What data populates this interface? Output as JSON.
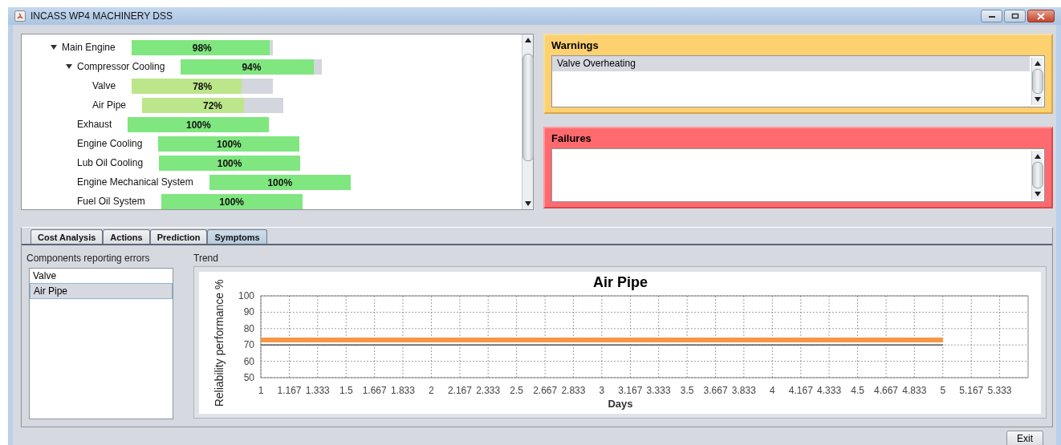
{
  "window": {
    "title": "INCASS WP4 MACHINERY DSS"
  },
  "tree": [
    {
      "label": "Main Engine",
      "level": 0.98,
      "reading": "98%",
      "expanded": true,
      "children": [
        {
          "label": "Compressor Cooling",
          "level": 0.94,
          "reading": "94%",
          "expanded": true,
          "children": [
            {
              "label": "Valve",
              "level": 0.78,
              "reading": "78%"
            },
            {
              "label": "Air Pipe",
              "level": 0.72,
              "reading": "72%"
            }
          ]
        },
        {
          "label": "Exhaust",
          "level": 1,
          "reading": "100%"
        },
        {
          "label": "Engine Cooling",
          "level": 1,
          "reading": "100%"
        },
        {
          "label": "Lub Oil Cooling",
          "level": 1,
          "reading": "100%"
        },
        {
          "label": "Engine Mechanical System",
          "level": 1,
          "reading": "100%"
        },
        {
          "label": "Fuel Oil System",
          "level": 1,
          "reading": "100%"
        }
      ]
    }
  ],
  "warnings": {
    "title": "Warnings",
    "items": [
      {
        "label": "Valve Overheating",
        "selected": true
      }
    ]
  },
  "failures": {
    "title": "Failures"
  },
  "tabs": [
    {
      "label": "Cost Analysis",
      "selected": false
    },
    {
      "label": "Actions",
      "selected": false
    },
    {
      "label": "Prediction",
      "selected": false
    },
    {
      "label": "Symptoms",
      "selected": true
    }
  ],
  "components": {
    "title": "Components reporting errors",
    "items": [
      {
        "label": "Valve",
        "selected": false
      },
      {
        "label": "Air Pipe",
        "selected": true
      }
    ]
  },
  "trend": {
    "title": "Trend",
    "chart_data": {
      "type": "line",
      "title": "Air Pipe",
      "xlabel": "Days",
      "ylabel": "Reliability performance %",
      "x": [
        1,
        5
      ],
      "series": [
        {
          "color": "#f79646",
          "values": [
            73,
            73
          ]
        },
        {
          "color": "#555555",
          "values": [
            70,
            70
          ]
        }
      ],
      "xlim": [
        1,
        5.5
      ],
      "ylim": [
        50,
        100
      ],
      "xticks": [
        {
          "value": 1,
          "label": "1"
        },
        {
          "value": 1.167,
          "label": "1.167"
        },
        {
          "value": 1.333,
          "label": "1.333"
        },
        {
          "value": 1.5,
          "label": "1.5"
        },
        {
          "value": 1.667,
          "label": "1.667"
        },
        {
          "value": 1.833,
          "label": "1.833"
        },
        {
          "value": 2,
          "label": "2"
        },
        {
          "value": 2.167,
          "label": "2.167"
        },
        {
          "value": 2.333,
          "label": "2.333"
        },
        {
          "value": 2.5,
          "label": "2.5"
        },
        {
          "value": 2.667,
          "label": "2.667"
        },
        {
          "value": 2.833,
          "label": "2.833"
        },
        {
          "value": 3,
          "label": "3"
        },
        {
          "value": 3.167,
          "label": "3.167"
        },
        {
          "value": 3.333,
          "label": "3.333"
        },
        {
          "value": 3.5,
          "label": "3.5"
        },
        {
          "value": 3.667,
          "label": "3.667"
        },
        {
          "value": 3.833,
          "label": "3.833"
        },
        {
          "value": 4,
          "label": "4"
        },
        {
          "value": 4.167,
          "label": "4.167"
        },
        {
          "value": 4.333,
          "label": "4.333"
        },
        {
          "value": 4.5,
          "label": "4.5"
        },
        {
          "value": 4.667,
          "label": "4.667"
        },
        {
          "value": 4.833,
          "label": "4.833"
        },
        {
          "value": 5,
          "label": "5"
        },
        {
          "value": 5.167,
          "label": "5.167"
        },
        {
          "value": 5.333,
          "label": "5.333"
        }
      ],
      "yticks": [
        50,
        60,
        70,
        80,
        90,
        100
      ],
      "grid": true
    }
  },
  "exit_button": "Exit"
}
